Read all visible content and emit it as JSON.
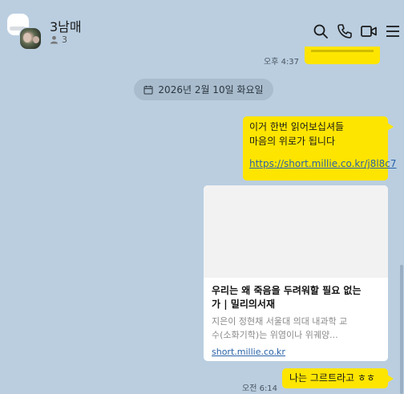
{
  "header": {
    "title": "3남매",
    "member_count": "3"
  },
  "messages": {
    "prev_time": "오후 4:37",
    "date_divider": "2026년 2월 10일 화요일",
    "msg1_line1": "이거 한번 읽어보십셔들",
    "msg1_line2": "마음의 위로가 됩니다",
    "msg1_link": "https://short.millie.co.kr/j8l8c7",
    "card_title_line1": "우리는 왜 죽음을 두려워할 필요 없는",
    "card_title_line2": "가 | 밀리의서재",
    "card_desc_line1": "지은이 정현채 서울대 의대 내과학 교",
    "card_desc_line2": "수(소화기학)는 위염이나 위궤양...",
    "card_domain": "short.millie.co.kr",
    "msg2_time": "오전 6:14",
    "msg2_text": "나는 그르트라고 ㅎㅎ"
  },
  "colors": {
    "background": "#bacee0",
    "my_bubble": "#fee500",
    "link": "#2962a8"
  },
  "icons": {
    "search": "search-icon",
    "call": "phone-icon",
    "video": "video-call-icon",
    "menu": "menu-icon",
    "members": "person-icon",
    "calendar": "calendar-icon"
  }
}
